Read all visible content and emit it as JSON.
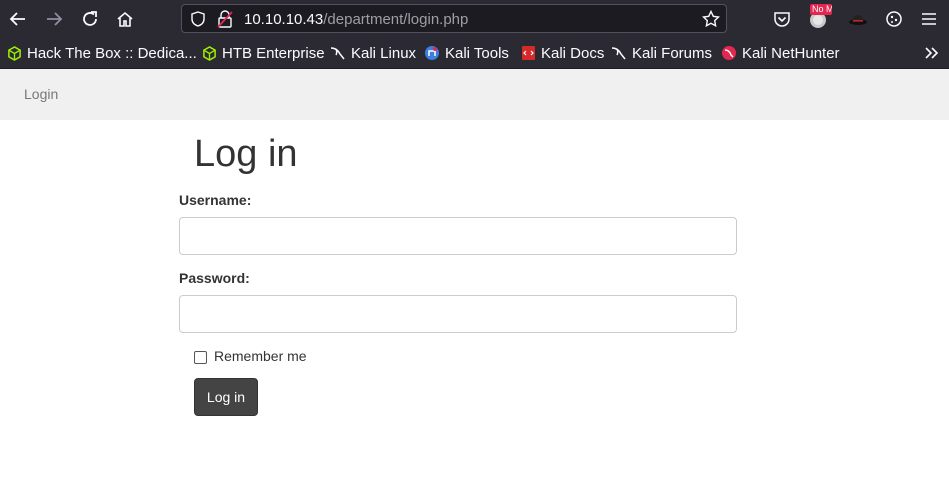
{
  "browser": {
    "url_host": "10.10.10.43",
    "url_path": "/department/login.php",
    "extension_badge": "No M"
  },
  "bookmarks": [
    {
      "label": "Hack The Box :: Dedica...",
      "icon": "htb-cube-icon"
    },
    {
      "label": "HTB Enterprise",
      "icon": "htb-cube-icon"
    },
    {
      "label": "Kali Linux",
      "icon": "kali-dragon-icon"
    },
    {
      "label": "Kali Tools",
      "icon": "kali-tools-icon"
    },
    {
      "label": "Kali Docs",
      "icon": "kali-docs-icon"
    },
    {
      "label": "Kali Forums",
      "icon": "kali-dragon-icon"
    },
    {
      "label": "Kali NetHunter",
      "icon": "nethunter-icon"
    }
  ],
  "navbar": {
    "link": "Login"
  },
  "form": {
    "title": "Log in",
    "username_label": "Username:",
    "username_value": "",
    "password_label": "Password:",
    "password_value": "",
    "remember_label": "Remember me",
    "remember_checked": false,
    "submit_label": "Log in"
  },
  "colors": {
    "chrome_bg": "#2b2a33",
    "urlbar_bg": "#1c1b22",
    "navbar_bg": "#f0f0f0",
    "button_bg": "#444444",
    "htb_green": "#9fef00"
  }
}
